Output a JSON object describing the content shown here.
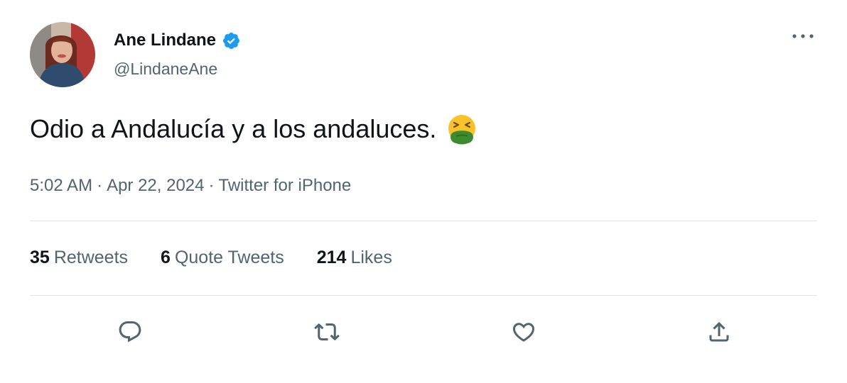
{
  "author": {
    "display_name": "Ane Lindane",
    "handle": "@LindaneAne",
    "verified": true
  },
  "tweet": {
    "text": "Odio a Andalucía y a los andaluces.",
    "emoji": "face-vomiting-icon"
  },
  "meta": {
    "time": "5:02 AM",
    "separator": "·",
    "date": "Apr 22, 2024",
    "source": "Twitter for iPhone"
  },
  "stats": {
    "retweets_count": "35",
    "retweets_label": "Retweets",
    "quotes_count": "6",
    "quotes_label": "Quote Tweets",
    "likes_count": "214",
    "likes_label": "Likes"
  },
  "actions": [
    "reply-icon",
    "retweet-icon",
    "like-icon",
    "share-icon"
  ],
  "colors": {
    "verified": "#1d9bf0",
    "secondary_text": "#536471",
    "primary_text": "#0f1419",
    "divider": "#dfe3e6",
    "emoji_face": "#f9c22b",
    "emoji_vomit": "#3d8b2f"
  }
}
